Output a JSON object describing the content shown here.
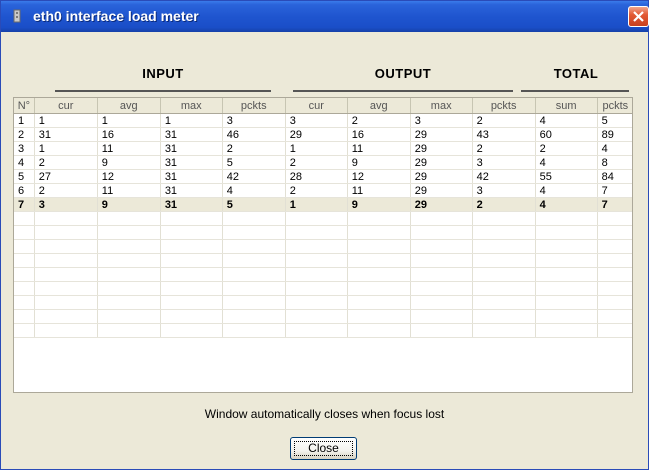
{
  "window": {
    "title": "eth0 interface load meter",
    "icon": "network-icon",
    "close_icon": "close-icon"
  },
  "groups": {
    "input": "INPUT",
    "output": "OUTPUT",
    "total": "TOTAL"
  },
  "table": {
    "columns": [
      "N°",
      "cur",
      "avg",
      "max",
      "pckts",
      "cur",
      "avg",
      "max",
      "pckts",
      "sum",
      "pckts"
    ],
    "rows": [
      [
        "1",
        "1",
        "1",
        "1",
        "3",
        "3",
        "2",
        "3",
        "2",
        "4",
        "5"
      ],
      [
        "2",
        "31",
        "16",
        "31",
        "46",
        "29",
        "16",
        "29",
        "43",
        "60",
        "89"
      ],
      [
        "3",
        "1",
        "11",
        "31",
        "2",
        "1",
        "11",
        "29",
        "2",
        "2",
        "4"
      ],
      [
        "4",
        "2",
        "9",
        "31",
        "5",
        "2",
        "9",
        "29",
        "3",
        "4",
        "8"
      ],
      [
        "5",
        "27",
        "12",
        "31",
        "42",
        "28",
        "12",
        "29",
        "42",
        "55",
        "84"
      ],
      [
        "6",
        "2",
        "11",
        "31",
        "4",
        "2",
        "11",
        "29",
        "3",
        "4",
        "7"
      ],
      [
        "7",
        "3",
        "9",
        "31",
        "5",
        "1",
        "9",
        "29",
        "2",
        "4",
        "7"
      ]
    ],
    "highlighted_row": 7
  },
  "footer": {
    "message": "Window automatically closes when focus lost",
    "close_label": "Close"
  },
  "colors": {
    "titlebar": "#1f55cf",
    "window_bg": "#ece9d8",
    "close_button": "#e35a35"
  }
}
